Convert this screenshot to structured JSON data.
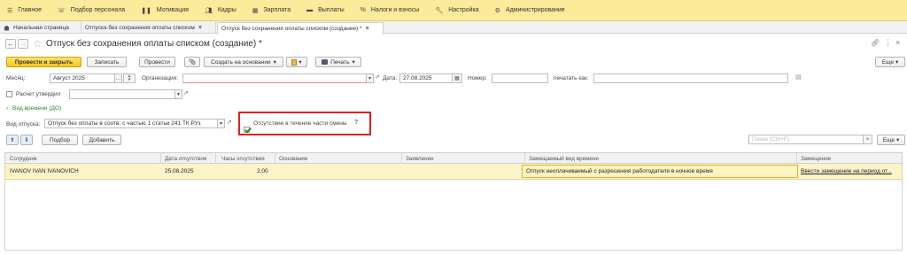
{
  "menu": [
    {
      "label": "Главное",
      "icon": "menu-lines-icon"
    },
    {
      "label": "Подбор персонала",
      "icon": "phone-user-icon"
    },
    {
      "label": "Мотивация",
      "icon": "trophy-icon"
    },
    {
      "label": "Кадры",
      "icon": "people-icon"
    },
    {
      "label": "Зарплата",
      "icon": "calculator-icon"
    },
    {
      "label": "Выплаты",
      "icon": "wallet-icon"
    },
    {
      "label": "Налоги и взносы",
      "icon": "percent-icon"
    },
    {
      "label": "Настройка",
      "icon": "wrench-icon"
    },
    {
      "label": "Администрирование",
      "icon": "gear-icon"
    }
  ],
  "tabs": {
    "home": "Начальная страница",
    "tab1": "Отпуска без сохранения оплаты списком",
    "tab2": "Отпуск без сохранения оплаты списком (создание) *"
  },
  "title": "Отпуск без сохранения оплаты списком (создание) *",
  "toolbar": {
    "post_close": "Провести и закрыть",
    "save": "Записать",
    "post": "Провести",
    "create_based": "Создать на основании",
    "print": "Печать",
    "more": "Еще"
  },
  "form": {
    "month_label": "Месяц:",
    "month_value": "Август 2025",
    "org_label": "Организация:",
    "org_value": "",
    "date_label": "Дата:",
    "date_value": "27.08.2025",
    "number_label": "Номер:",
    "number_value": "",
    "print_as_label": "печатать как:",
    "approved_label": "Расчет утвердил",
    "time_type_link": "Вид времени (ДО)",
    "leave_type_label": "Вид отпуска:",
    "leave_type_value": "Отпуск без оплаты в соотв. с частью 1 статьи 241 ТК РУз",
    "partial_shift_label": "Отсутствие в течение части смены",
    "help": "?"
  },
  "tabletools": {
    "select": "Подбор",
    "add": "Добавить",
    "search_placeholder": "Поиск (Ctrl+F)",
    "more": "Еще"
  },
  "table": {
    "columns": [
      "Сотрудник",
      "Дата отсутствия",
      "Часы отсутствия",
      "Основание",
      "Заявление",
      "Замещаемый вид времени",
      "Замещение"
    ],
    "rows": [
      {
        "employee": "IVANOV IVAN IVANOVICH",
        "date": "25.08.2025",
        "hours": "2,00",
        "basis": "",
        "application": "",
        "time_type": "Отпуск неоплачиваемый с разрешения работодателя в ночное время",
        "replacement": "Ввести замещение на период от..."
      }
    ]
  }
}
